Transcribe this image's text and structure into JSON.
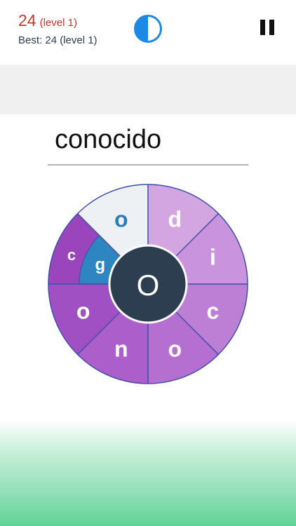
{
  "header": {
    "score": "24",
    "score_level": "(level 1)",
    "best": "Best: 24 (level 1)"
  },
  "timer": {
    "fraction_remaining": 0.5,
    "color": "#1e88e5"
  },
  "current_word": "conocido",
  "wheel": {
    "center_letter": "O",
    "tiles": [
      {
        "letter": "d",
        "color": "#d3a6e2",
        "text_color": "#ffffff"
      },
      {
        "letter": "i",
        "color": "#c994dd",
        "text_color": "#ffffff"
      },
      {
        "letter": "c",
        "color": "#bd7fd6",
        "text_color": "#ffffff"
      },
      {
        "letter": "o",
        "color": "#b56fd0",
        "text_color": "#ffffff"
      },
      {
        "letter": "n",
        "color": "#ac5fcb",
        "text_color": "#ffffff"
      },
      {
        "letter": "o",
        "color": "#a150c4",
        "text_color": "#ffffff"
      },
      {
        "letter": "c",
        "color": "#9a45bb",
        "text_color": "#ffffff"
      },
      {
        "letter": "o",
        "color": "#eef1f3",
        "text_color": "#2e7dbb"
      }
    ],
    "selected_tile": {
      "letter": "g",
      "color": "#2e86c1",
      "text_color": "#ffffff"
    },
    "outline_color": "#3f4fa8",
    "center_color": "#2c3e50"
  }
}
